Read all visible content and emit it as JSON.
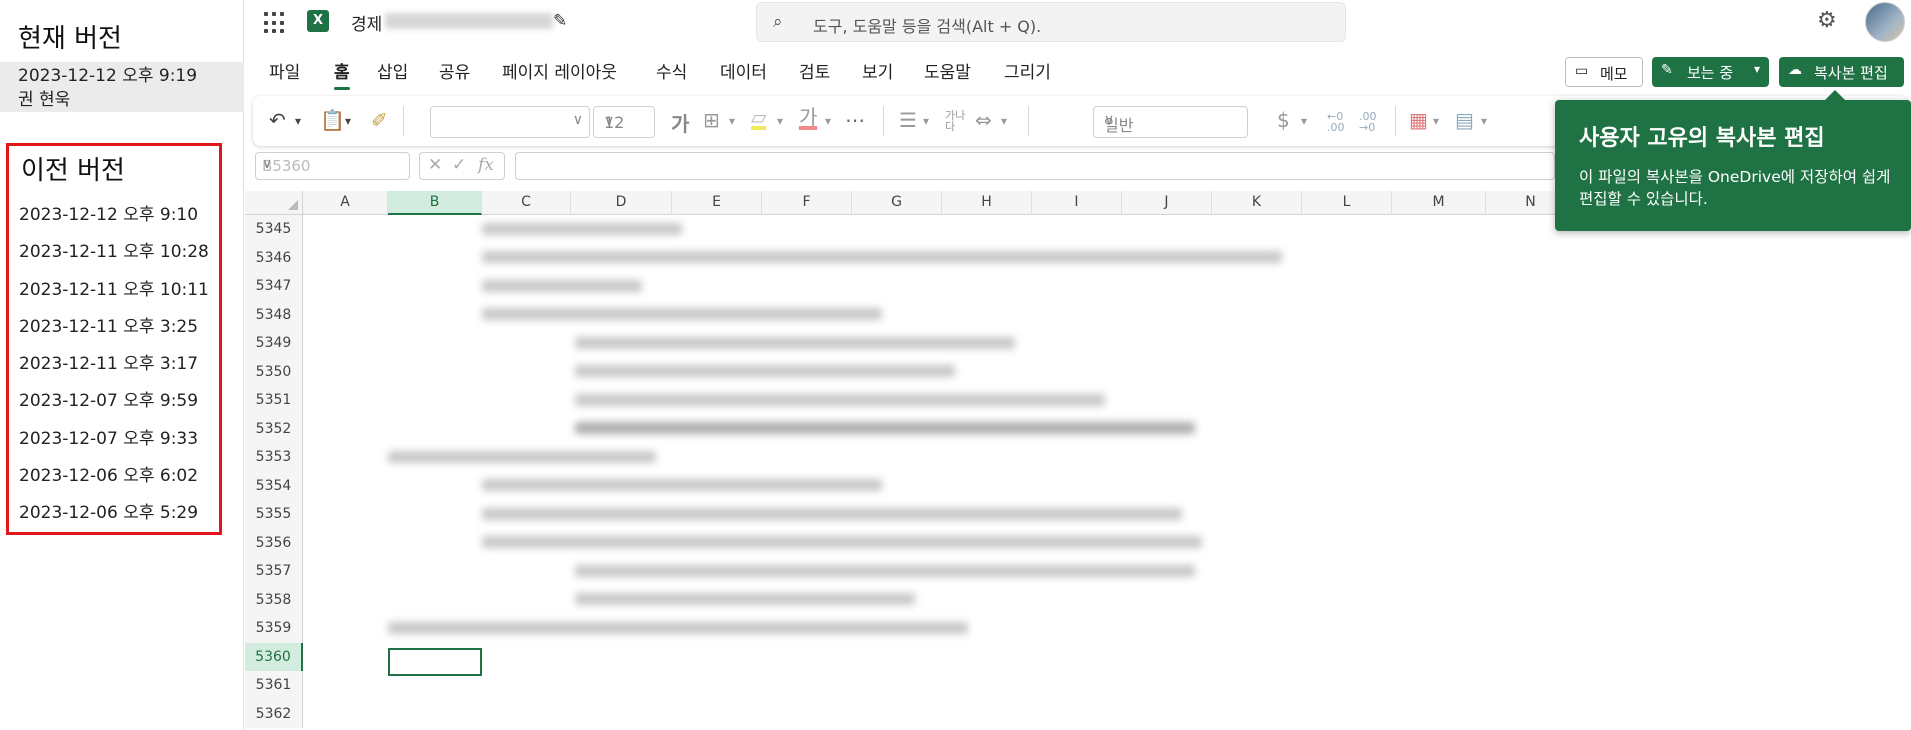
{
  "version_panel": {
    "current_heading": "현재 버전",
    "current_date": "2023-12-12 오후 9:19",
    "current_author": "권 현욱",
    "previous_heading": "이전 버전",
    "previous_versions": [
      "2023-12-12 오후 9:10",
      "2023-12-11 오후 10:28",
      "2023-12-11 오후 10:11",
      "2023-12-11 오후 3:25",
      "2023-12-11 오후 3:17",
      "2023-12-07 오후 9:59",
      "2023-12-07 오후 9:33",
      "2023-12-06 오후 6:02",
      "2023-12-06 오후 5:29"
    ]
  },
  "topbar": {
    "doc_title_prefix": "경제",
    "search_placeholder": "도구, 도움말 등을 검색(Alt + Q)."
  },
  "ribbon": {
    "tabs": [
      "파일",
      "홈",
      "삽입",
      "공유",
      "페이지 레이아웃",
      "수식",
      "데이터",
      "검토",
      "보기",
      "도움말",
      "그리기"
    ],
    "active_tab": "홈",
    "memo_label": "메모",
    "viewing_label": "보는 중",
    "edit_copy_label": "복사본 편집"
  },
  "toolbar": {
    "font_size": "12",
    "number_format": "일반"
  },
  "formula_bar": {
    "name_box": "B5360"
  },
  "grid": {
    "columns": [
      "A",
      "B",
      "C",
      "D",
      "E",
      "F",
      "G",
      "H",
      "I",
      "J",
      "K",
      "L",
      "M",
      "N"
    ],
    "selected_column": "B",
    "rows": [
      "5345",
      "5346",
      "5347",
      "5348",
      "5349",
      "5350",
      "5351",
      "5352",
      "5353",
      "5354",
      "5355",
      "5356",
      "5357",
      "5358",
      "5359",
      "5360",
      "5361",
      "5362"
    ],
    "selected_row": "5360"
  },
  "tooltip": {
    "title": "사용자 고유의 복사본 편집",
    "body": "이 파일의 복사본을 OneDrive에 저장하여 쉽게 편집할 수 있습니다."
  },
  "colors": {
    "excel_green": "#1f7244",
    "highlight_box": "#e0161b"
  }
}
